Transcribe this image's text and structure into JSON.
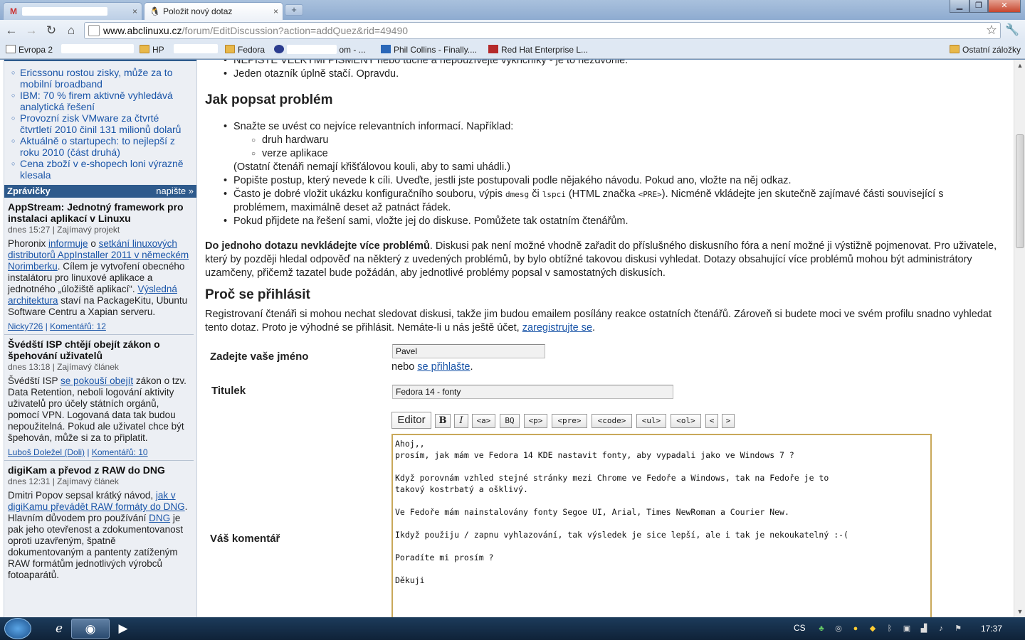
{
  "browser": {
    "tabs": [
      {
        "label": "",
        "icon": "gmail-icon"
      },
      {
        "label": "Položit nový dotaz",
        "icon": "tux-icon"
      }
    ],
    "tab_close_glyph": "×",
    "newtab_glyph": "+",
    "url_host": "www.abclinuxu.cz",
    "url_path": "/forum/EditDiscussion?action=addQuez&rid=49490",
    "window_controls": {
      "min": "▁",
      "max": "❐",
      "close": "✕"
    }
  },
  "bookmarks": [
    {
      "label": "Evropa 2",
      "icon": "page"
    },
    {
      "label": "HP",
      "icon": "folder"
    },
    {
      "label": "Fedora",
      "icon": "folder"
    },
    {
      "label": "om - ...",
      "icon": "globe"
    },
    {
      "label": "Phil Collins - Finally....",
      "icon": "mp"
    },
    {
      "label": "Red Hat Enterprise L...",
      "icon": "rh"
    },
    {
      "label": "Ostatní záložky",
      "icon": "folder"
    }
  ],
  "sidebar": {
    "top_links": [
      "Ericssonu rostou zisky, může za to mobilní broadband",
      "IBM: 70 % firem aktivně vyhledává analytická řešení",
      "Provozní zisk VMware za čtvrté čtvrtletí 2010 činil 131 milionů dolarů",
      "Aktuálně o startupech: to nejlepší z roku 2010 (část druhá)",
      "Cena zboží v e-shopech loni výrazně klesala"
    ],
    "header": {
      "title": "Zprávičky",
      "action": "napište »"
    },
    "news": [
      {
        "title": "AppStream: Jednotný framework pro instalaci aplikací v Linuxu",
        "meta": "dnes 15:27 | Zajímavý projekt",
        "body": [
          {
            "t": "Phoronix "
          },
          {
            "a": "informuje"
          },
          {
            "t": " o "
          },
          {
            "a": "setkání linuxových distributorů AppInstaller 2011 v německém Norimberku"
          },
          {
            "t": ". Cílem je vytvoření obecného instalátoru pro linuxové aplikace a jednotného „úložiště aplikací“. "
          },
          {
            "a": "Výsledná architektura"
          },
          {
            "t": " staví na PackageKitu, Ubuntu Software Centru a Xapian serveru."
          }
        ],
        "author": "Nicky726",
        "comments": "Komentářů: 12"
      },
      {
        "title": "Švédští ISP chtějí obejít zákon o špehování uživatelů",
        "meta": "dnes 13:18 | Zajímavý článek",
        "body": [
          {
            "t": "Švédští ISP "
          },
          {
            "a": "se pokouší obejít"
          },
          {
            "t": " zákon o tzv. Data Retention, neboli logování aktivity uživatelů pro účely státních orgánů, pomocí VPN. Logovaná data tak budou nepoužitelná. Pokud ale uživatel chce být špehován, může si za to připlatit."
          }
        ],
        "author": "Luboš Doležel (Doli)",
        "comments": "Komentářů: 10"
      },
      {
        "title": "digiKam a převod z RAW do DNG",
        "meta": "dnes 12:31 | Zajímavý článek",
        "body": [
          {
            "t": "Dmitri Popov sepsal krátký návod, "
          },
          {
            "a": "jak v digiKamu převádět RAW formáty do DNG"
          },
          {
            "t": ". Hlavním důvodem pro používání "
          },
          {
            "a": "DNG"
          },
          {
            "t": " je pak jeho otevřenost a zdokumentovanost oproti uzavřeným, špatně dokumentovaným a pantenty zatíženým RAW formátům jednotlivých výrobců fotoaparátů."
          }
        ],
        "author": "",
        "comments": ""
      }
    ]
  },
  "content": {
    "top_bullets": [
      "NEPIŠTE VELKÝMI PÍSMENY nebo tučně a nepoužívejte vykřičníky - je to nezdvořilé.",
      "Jeden otazník úplně stačí. Opravdu."
    ],
    "h_problem": "Jak popsat problém",
    "problem_intro": "Snažte se uvést co nejvíce relevantních informací. Například:",
    "problem_sub": [
      "druh hardwaru",
      "verze aplikace"
    ],
    "problem_note": "(Ostatní čtenáři nemají křišťálovou kouli, aby to sami uhádli.)",
    "problem_b2": "Popište postup, který nevede k cíli. Uveďte, jestli jste postupovali podle nějakého návodu. Pokud ano, vložte na něj odkaz.",
    "problem_b3a": "Často je dobré vložit ukázku konfiguračního souboru, výpis ",
    "problem_b3_code1": "dmesg",
    "problem_b3b": " či ",
    "problem_b3_code2": "lspci",
    "problem_b3c": " (HTML značka ",
    "problem_b3_code3": "<PRE>",
    "problem_b3d": "). Nicméně vkládejte jen skutečně zajímavé části související s",
    "problem_b3e": "problémem, maximálně deset až patnáct řádek.",
    "problem_b4": "Pokud přijdete na řešení sami, vložte jej do diskuse. Pomůžete tak ostatním čtenářům.",
    "multi_bold": "Do jednoho dotazu nevkládejte více problémů",
    "multi_text": ". Diskusi pak není možné vhodně zařadit do příslušného diskusního fóra a není možné ji výstižně pojmenovat. Pro uživatele, který by později hledal odpověď na některý z uvedených problémů, by bylo obtížné takovou diskusi vyhledat. Dotazy obsahující více problémů mohou být administrátory uzamčeny, přičemž tazatel bude požádán, aby jednotlivé problémy popsal v samostatných diskusích.",
    "h_login": "Proč se přihlásit",
    "login_text": "Registrovaní čtenáři si mohou nechat sledovat diskusi, takže jim budou emailem posílány reakce ostatních čtenářů. Zároveň si budete moci ve svém profilu snadno vyhledat tento dotaz. Proto je výhodné se přihlásit. Nemáte-li u nás ještě účet, ",
    "login_link": "zaregistrujte se",
    "login_end": "."
  },
  "form": {
    "name_label": "Zadejte vaše jméno",
    "name_value": "Pavel",
    "or_text": "nebo ",
    "login_link": "se přihlašte",
    "title_label": "Titulek",
    "title_value": "Fedora 14 - fonty",
    "editor_label": "Editor",
    "editor_buttons": [
      "B",
      "I",
      "<a>",
      "BQ",
      "<p>",
      "<pre>",
      "<code>",
      "<ul>",
      "<ol>",
      "<",
      ">"
    ],
    "comment_label": "Váš komentář",
    "comment_value": "Ahoj,,\nprosím, jak mám ve Fedora 14 KDE nastavit fonty, aby vypadali jako ve Windows 7 ?\n\nKdyž porovnám vzhled stejné stránky mezi Chrome ve Fedoře a Windows, tak na Fedoře je to\ntakový kostrbatý a ošklivý.\n\nVe Fedoře mám nainstalovány fonty Segoe UI, Arial, Times NewRoman a Courier New.\n\nIkdyž použiju / zapnu vyhlazování, tak výsledek je sice lepší, ale i tak je nekoukatelný :-(\n\nPoradíte mi prosím ?\n\nDěkuji"
  },
  "taskbar": {
    "lang": "CS",
    "clock": "17:37"
  },
  "colors": {
    "link": "#1a55a8",
    "sidebar_header": "#2e5a8c",
    "textarea_border": "#c9a85a"
  }
}
